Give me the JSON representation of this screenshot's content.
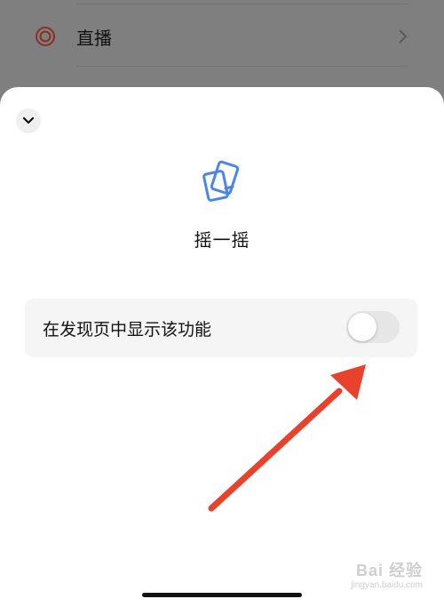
{
  "background": {
    "row_label": "直播",
    "row_icon": "live-ring-icon",
    "row_chevron": "chevron-right-icon"
  },
  "sheet": {
    "collapse_icon": "chevron-down-icon",
    "feature_icon": "shake-phones-icon",
    "feature_title": "摇一摇",
    "setting_label": "在发现页中显示该功能",
    "toggle_on": false
  },
  "watermark": {
    "logo_text": "Bai 经验",
    "url": "jingyan.baidu.com"
  },
  "colors": {
    "accent_icon": "#4a86e8",
    "live_icon": "#c03c2c",
    "arrow": "#e8422c"
  }
}
